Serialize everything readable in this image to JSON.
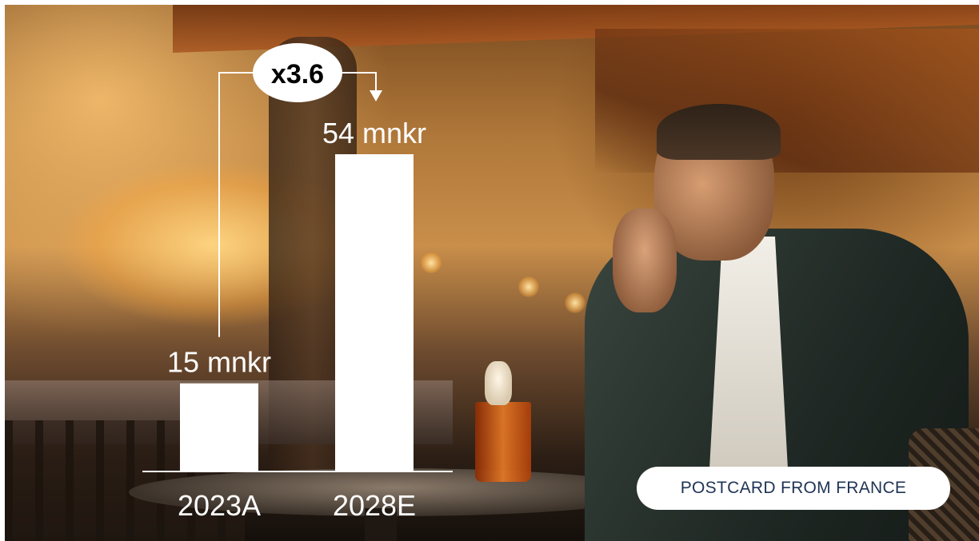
{
  "chart_data": {
    "type": "bar",
    "categories": [
      "2023A",
      "2028E"
    ],
    "values": [
      15,
      54
    ],
    "value_labels": [
      "15 mnkr",
      "54 mnkr"
    ],
    "title": "",
    "xlabel": "",
    "ylabel": "",
    "annotation": "x3.6",
    "ylim": [
      0,
      54
    ],
    "grid": false,
    "bar_color": "#ffffff",
    "text_color": "#ffffff"
  },
  "badge": {
    "label": "POSTCARD FROM FRANCE"
  }
}
